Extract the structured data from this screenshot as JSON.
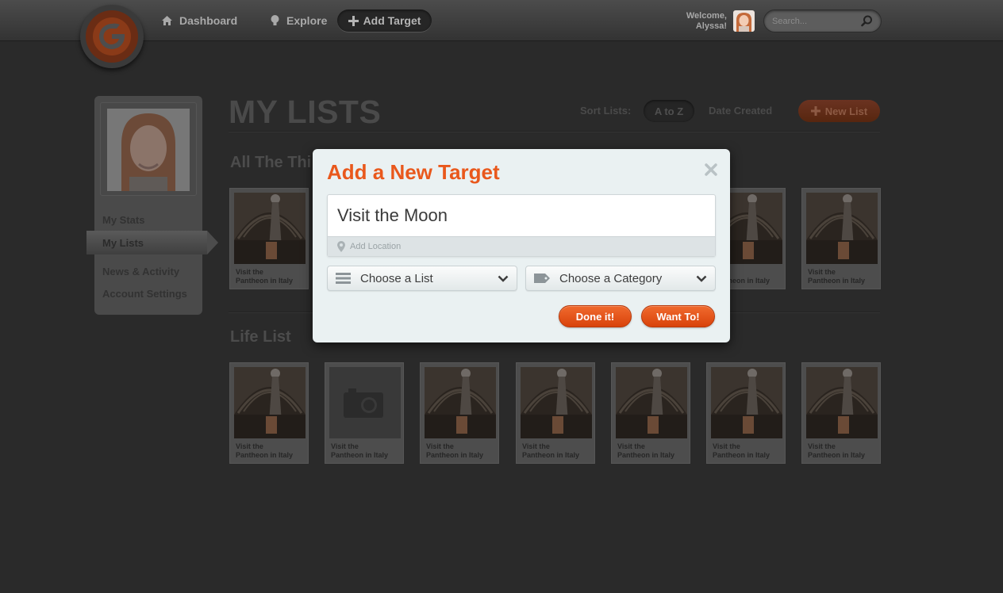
{
  "nav": {
    "dashboard_label": "Dashboard",
    "explore_label": "Explore",
    "add_target_label": "Add Target",
    "welcome_line1": "Welcome,",
    "welcome_line2": "Alyssa!",
    "search_placeholder": "Search..."
  },
  "sidebar": {
    "items": [
      {
        "label": "My Stats"
      },
      {
        "label": "My Lists"
      },
      {
        "label": "News & Activity"
      },
      {
        "label": "Account Settings"
      }
    ],
    "active_index": 1
  },
  "main": {
    "title": "MY LISTS",
    "sort_label": "Sort Lists:",
    "sort_options": [
      "A to Z",
      "Date Created"
    ],
    "new_list_label": "New List",
    "sections": [
      {
        "title": "All The Thi",
        "cards": [
          {
            "line1": "Visit the",
            "line2": "Pantheon in Italy"
          },
          {
            "line1": "the",
            "line2": "Pantheon in Italy"
          },
          {
            "line1": "Visit the",
            "line2": "Pantheon in Italy"
          }
        ]
      },
      {
        "title": "Life List",
        "cards": [
          {
            "line1": "Visit the",
            "line2": "Pantheon in Italy",
            "image": "pantheon"
          },
          {
            "line1": "Visit the",
            "line2": "Pantheon in Italy",
            "image": "camera-placeholder"
          },
          {
            "line1": "Visit the",
            "line2": "Pantheon in Italy",
            "image": "pantheon"
          },
          {
            "line1": "Visit the",
            "line2": "Pantheon in Italy",
            "image": "pantheon"
          },
          {
            "line1": "Visit the",
            "line2": "Pantheon in Italy",
            "image": "pantheon"
          },
          {
            "line1": "Visit the",
            "line2": "Pantheon in Italy",
            "image": "pantheon"
          },
          {
            "line1": "Visit the",
            "line2": "Pantheon in Italy",
            "image": "pantheon"
          }
        ]
      }
    ]
  },
  "modal": {
    "title": "Add a New Target",
    "target_value": "Visit the Moon",
    "location_placeholder": "Add Location",
    "list_dropdown": "Choose a List",
    "category_dropdown": "Choose a Category",
    "done_label": "Done it!",
    "want_label": "Want To!"
  },
  "colors": {
    "accent": "#e9581c",
    "background": "#2a2a2a",
    "modal_bg": "#eaf1f2"
  },
  "icons": [
    "logo-g-icon",
    "home-icon",
    "bulb-icon",
    "plus-icon",
    "search-icon",
    "close-icon",
    "location-pin-icon",
    "list-icon",
    "tag-icon",
    "chevron-down-icon",
    "camera-icon"
  ]
}
